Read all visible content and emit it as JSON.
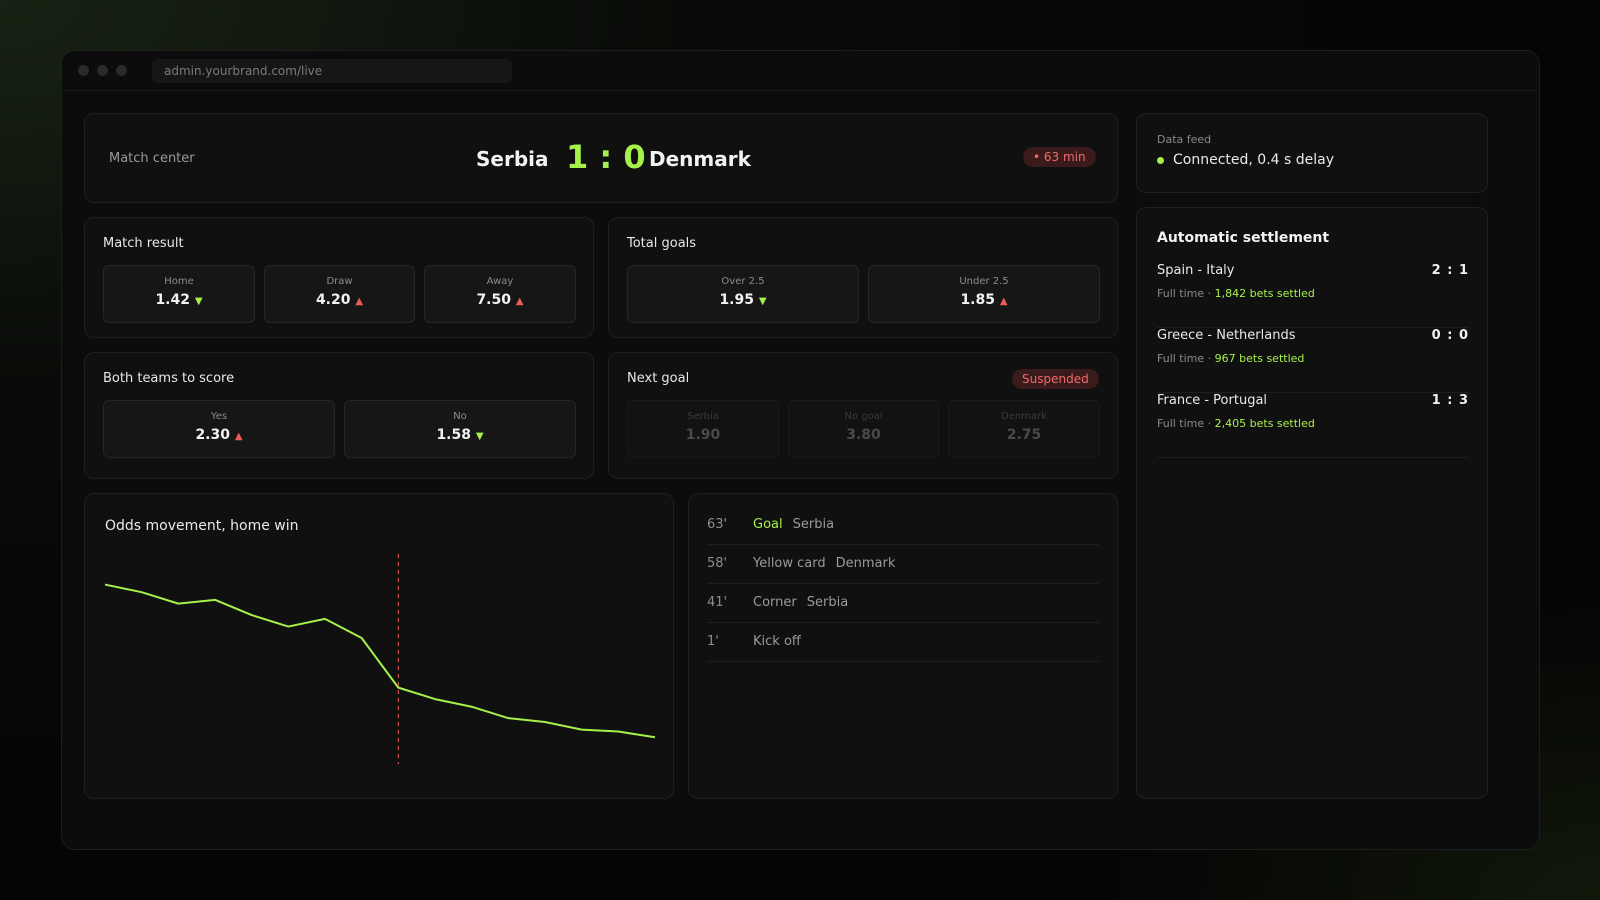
{
  "browser": {
    "url": "admin.yourbrand.com/live"
  },
  "header": {
    "section_label": "Match center",
    "home_team": "Serbia",
    "away_team": "Denmark",
    "score": "1 : 0",
    "live_badge": "• 63 min"
  },
  "data_feed": {
    "label": "Data feed",
    "status": "Connected, 0.4 s delay"
  },
  "markets": {
    "match_result": {
      "title": "Match result",
      "options": [
        {
          "label": "Home",
          "value": "1.42",
          "trend": "down"
        },
        {
          "label": "Draw",
          "value": "4.20",
          "trend": "up"
        },
        {
          "label": "Away",
          "value": "7.50",
          "trend": "up"
        }
      ]
    },
    "total_goals": {
      "title": "Total goals",
      "options": [
        {
          "label": "Over 2.5",
          "value": "1.95",
          "trend": "down"
        },
        {
          "label": "Under 2.5",
          "value": "1.85",
          "trend": "up"
        }
      ]
    },
    "btts": {
      "title": "Both teams to score",
      "options": [
        {
          "label": "Yes",
          "value": "2.30",
          "trend": "up"
        },
        {
          "label": "No",
          "value": "1.58",
          "trend": "down"
        }
      ]
    },
    "next_goal": {
      "title": "Next goal",
      "status": "Suspended",
      "options": [
        {
          "label": "Serbia",
          "value": "1.90"
        },
        {
          "label": "No goal",
          "value": "3.80"
        },
        {
          "label": "Denmark",
          "value": "2.75"
        }
      ]
    },
    "trend_glyphs": {
      "down": "▼",
      "up": "▲"
    }
  },
  "odds_chart": {
    "title": "Odds movement, home win"
  },
  "chart_data": {
    "type": "line",
    "title": "Odds movement, home win",
    "xlabel": "",
    "ylabel": "",
    "grid": false,
    "x": [
      0,
      1,
      2,
      3,
      4,
      5,
      6,
      7,
      8,
      9,
      10,
      11,
      12,
      13,
      14,
      15
    ],
    "series": [
      {
        "values": [
          1.72,
          1.7,
          1.67,
          1.68,
          1.64,
          1.61,
          1.63,
          1.58,
          1.45,
          1.42,
          1.4,
          1.37,
          1.36,
          1.34,
          1.335,
          1.32
        ]
      }
    ],
    "ylim": [
      1.25,
      1.8
    ],
    "event_marker_x": 8,
    "line_color": "#a6f04b",
    "marker_color": "#ef5b5b"
  },
  "events": [
    {
      "minute": "63'",
      "type": "Goal",
      "team": "Serbia",
      "highlight": true
    },
    {
      "minute": "58'",
      "type": "Yellow card",
      "team": "Denmark",
      "highlight": false
    },
    {
      "minute": "41'",
      "type": "Corner",
      "team": "Serbia",
      "highlight": false
    },
    {
      "minute": "1'",
      "type": "Kick off",
      "team": "",
      "highlight": false
    }
  ],
  "settlement": {
    "title": "Automatic settlement",
    "items": [
      {
        "teams": "Spain - Italy",
        "score": "2 : 1",
        "status": "Full time · ",
        "bets": "1,842 bets settled"
      },
      {
        "teams": "Greece - Netherlands",
        "score": "0 : 0",
        "status": "Full time · ",
        "bets": "967 bets settled"
      },
      {
        "teams": "France - Portugal",
        "score": "1 : 3",
        "status": "Full time · ",
        "bets": "2,405 bets settled"
      }
    ]
  },
  "colors": {
    "accent": "#a6f04b",
    "danger": "#ef5b5b",
    "panel": "#101010"
  }
}
